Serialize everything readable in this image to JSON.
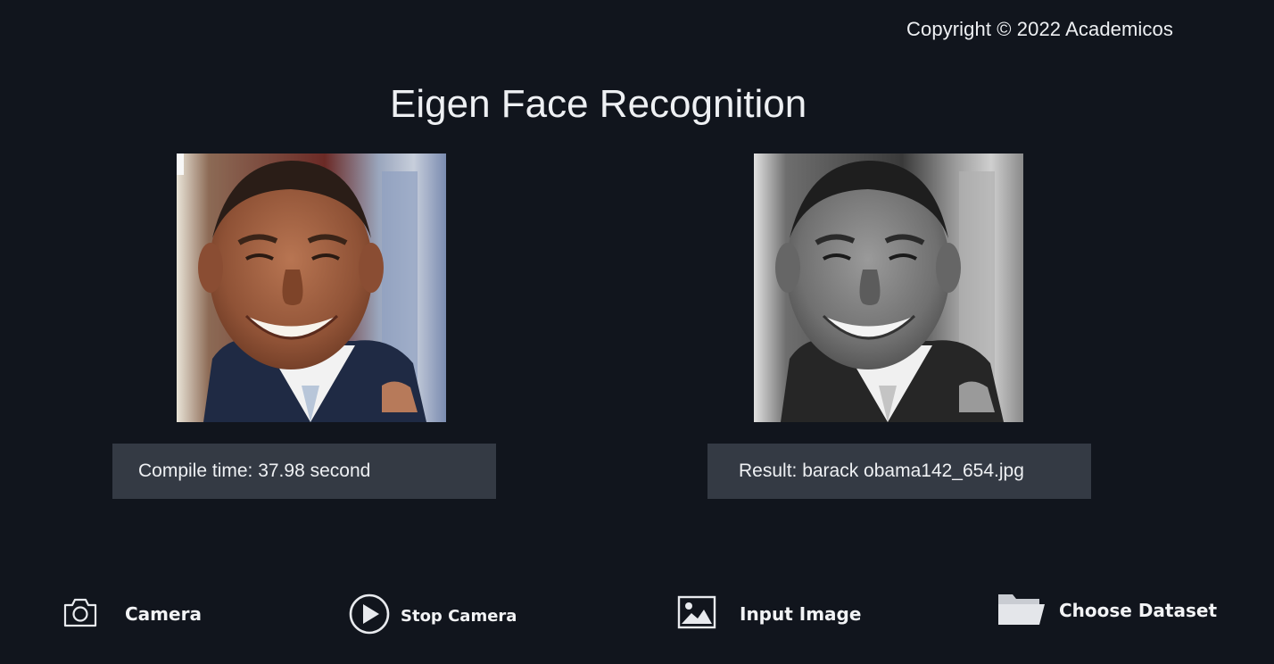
{
  "copyright": "Copyright © 2022 Academicos",
  "title": "Eigen Face Recognition",
  "images": {
    "input": {
      "alt": "Input face image",
      "mode": "color"
    },
    "result": {
      "alt": "Matched dataset face image",
      "mode": "grayscale"
    }
  },
  "compile_time": "Compile time: 37.98 second",
  "result": "Result: barack obama142_654.jpg",
  "buttons": {
    "camera": {
      "label": "Camera",
      "icon": "camera-icon"
    },
    "stop_camera": {
      "label": "Stop Camera",
      "icon": "play-circle-icon"
    },
    "input_image": {
      "label": "Input Image",
      "icon": "image-icon"
    },
    "choose_dataset": {
      "label": "Choose Dataset",
      "icon": "folder-icon"
    }
  },
  "colors": {
    "background": "#11151d",
    "info_box": "#343a44",
    "text": "#eef0f3"
  }
}
